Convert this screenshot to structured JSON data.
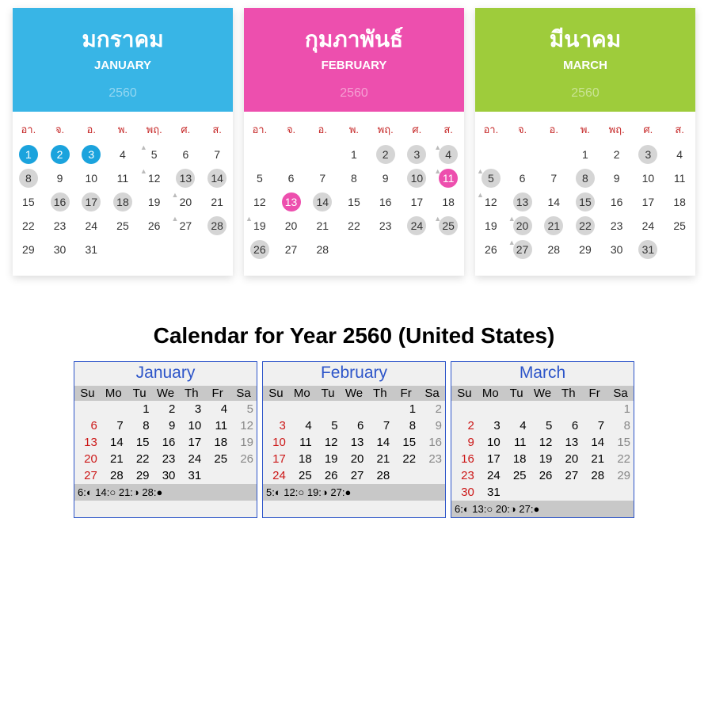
{
  "thai": {
    "weekdays": [
      "อา.",
      "จ.",
      "อ.",
      "พ.",
      "พฤ.",
      "ศ.",
      "ส."
    ],
    "year": "2560",
    "months": [
      {
        "th": "มกราคม",
        "en": "JANUARY",
        "grid": [
          [
            {
              "n": 1,
              "hi": "blue"
            },
            {
              "n": 2,
              "hi": "blue"
            },
            {
              "n": 3,
              "hi": "blue"
            },
            {
              "n": 4
            },
            {
              "n": 5,
              "moon": true
            },
            {
              "n": 6
            },
            {
              "n": 7
            }
          ],
          [
            {
              "n": 8,
              "hi": "gray"
            },
            {
              "n": 9
            },
            {
              "n": 10
            },
            {
              "n": 11
            },
            {
              "n": 12,
              "moon": true
            },
            {
              "n": 13,
              "hi": "gray"
            },
            {
              "n": 14,
              "hi": "gray"
            }
          ],
          [
            {
              "n": 15
            },
            {
              "n": 16,
              "hi": "gray"
            },
            {
              "n": 17,
              "hi": "gray"
            },
            {
              "n": 18,
              "hi": "gray"
            },
            {
              "n": 19
            },
            {
              "n": 20,
              "moon": true
            },
            {
              "n": 21
            }
          ],
          [
            {
              "n": 22
            },
            {
              "n": 23
            },
            {
              "n": 24
            },
            {
              "n": 25
            },
            {
              "n": 26
            },
            {
              "n": 27,
              "moon": true
            },
            {
              "n": 28,
              "hi": "gray"
            }
          ],
          [
            {
              "n": 29
            },
            {
              "n": 30
            },
            {
              "n": 31
            },
            {},
            {},
            {},
            {}
          ]
        ]
      },
      {
        "th": "กุมภาพันธ์",
        "en": "FEBRUARY",
        "grid": [
          [
            {},
            {},
            {},
            {
              "n": 1
            },
            {
              "n": 2,
              "hi": "gray"
            },
            {
              "n": 3,
              "hi": "gray"
            },
            {
              "n": 4,
              "hi": "gray",
              "moon": true
            }
          ],
          [
            {
              "n": 5
            },
            {
              "n": 6
            },
            {
              "n": 7
            },
            {
              "n": 8
            },
            {
              "n": 9
            },
            {
              "n": 10,
              "hi": "gray"
            },
            {
              "n": 11,
              "hi": "pink",
              "moon": true
            }
          ],
          [
            {
              "n": 12
            },
            {
              "n": 13,
              "hi": "pink"
            },
            {
              "n": 14,
              "hi": "gray"
            },
            {
              "n": 15
            },
            {
              "n": 16
            },
            {
              "n": 17
            },
            {
              "n": 18
            }
          ],
          [
            {
              "n": 19,
              "moon": true
            },
            {
              "n": 20
            },
            {
              "n": 21
            },
            {
              "n": 22
            },
            {
              "n": 23
            },
            {
              "n": 24,
              "hi": "gray"
            },
            {
              "n": 25,
              "hi": "gray",
              "moon": true
            }
          ],
          [
            {
              "n": 26,
              "hi": "gray"
            },
            {
              "n": 27
            },
            {
              "n": 28
            },
            {},
            {},
            {},
            {}
          ]
        ]
      },
      {
        "th": "มีนาคม",
        "en": "MARCH",
        "grid": [
          [
            {},
            {},
            {},
            {
              "n": 1
            },
            {
              "n": 2
            },
            {
              "n": 3,
              "hi": "gray"
            },
            {
              "n": 4
            }
          ],
          [
            {
              "n": 5,
              "hi": "gray",
              "moon": true
            },
            {
              "n": 6
            },
            {
              "n": 7
            },
            {
              "n": 8,
              "hi": "gray"
            },
            {
              "n": 9
            },
            {
              "n": 10
            },
            {
              "n": 11
            }
          ],
          [
            {
              "n": 12,
              "moon": true
            },
            {
              "n": 13,
              "hi": "gray"
            },
            {
              "n": 14
            },
            {
              "n": 15,
              "hi": "gray"
            },
            {
              "n": 16
            },
            {
              "n": 17
            },
            {
              "n": 18
            }
          ],
          [
            {
              "n": 19
            },
            {
              "n": 20,
              "hi": "gray",
              "moon": true
            },
            {
              "n": 21,
              "hi": "gray"
            },
            {
              "n": 22,
              "hi": "gray"
            },
            {
              "n": 23
            },
            {
              "n": 24
            },
            {
              "n": 25
            }
          ],
          [
            {
              "n": 26
            },
            {
              "n": 27,
              "hi": "gray",
              "moon": true
            },
            {
              "n": 28
            },
            {
              "n": 29
            },
            {
              "n": 30
            },
            {
              "n": 31,
              "hi": "gray"
            },
            {}
          ]
        ]
      }
    ]
  },
  "us": {
    "title": "Calendar for Year 2560 (United States)",
    "weekdays": [
      "Su",
      "Mo",
      "Tu",
      "We",
      "Th",
      "Fr",
      "Sa"
    ],
    "months": [
      {
        "name": "January",
        "moon": "6:◐ 14:○ 21:◑ 28:●",
        "grid": [
          [
            "",
            "",
            1,
            2,
            3,
            4,
            5
          ],
          [
            6,
            7,
            8,
            9,
            10,
            11,
            12
          ],
          [
            13,
            14,
            15,
            16,
            17,
            18,
            19
          ],
          [
            20,
            21,
            22,
            23,
            24,
            25,
            26
          ],
          [
            27,
            28,
            29,
            30,
            31,
            "",
            ""
          ]
        ]
      },
      {
        "name": "February",
        "moon": "5:◐ 12:○ 19:◑ 27:●",
        "grid": [
          [
            "",
            "",
            "",
            "",
            "",
            1,
            2
          ],
          [
            3,
            4,
            5,
            6,
            7,
            8,
            9
          ],
          [
            10,
            11,
            12,
            13,
            14,
            15,
            16
          ],
          [
            17,
            18,
            19,
            20,
            21,
            22,
            23
          ],
          [
            24,
            25,
            26,
            27,
            28,
            "",
            ""
          ]
        ]
      },
      {
        "name": "March",
        "moon": "6:◐ 13:○ 20:◑ 27:●",
        "grid": [
          [
            "",
            "",
            "",
            "",
            "",
            "",
            1
          ],
          [
            2,
            3,
            4,
            5,
            6,
            7,
            8
          ],
          [
            9,
            10,
            11,
            12,
            13,
            14,
            15
          ],
          [
            16,
            17,
            18,
            19,
            20,
            21,
            22
          ],
          [
            23,
            24,
            25,
            26,
            27,
            28,
            29
          ],
          [
            30,
            31,
            "",
            "",
            "",
            "",
            ""
          ]
        ]
      }
    ]
  }
}
